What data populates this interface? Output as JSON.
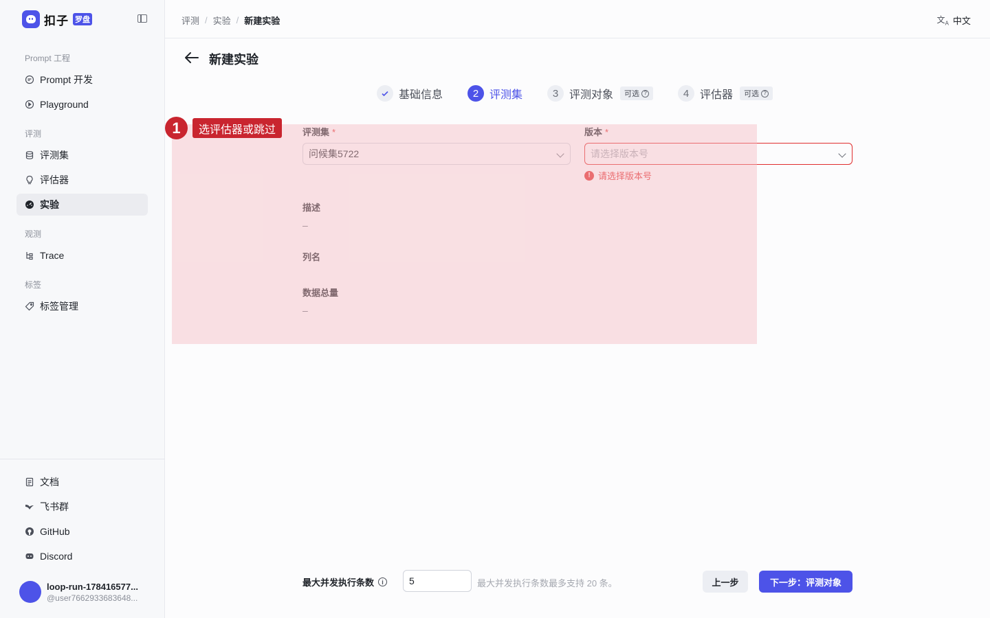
{
  "brand": {
    "name": "扣子",
    "badge": "罗盘"
  },
  "sidebar": {
    "groups": [
      {
        "label": "Prompt 工程",
        "items": [
          {
            "label": "Prompt 开发",
            "icon": "chat-bubble-icon"
          },
          {
            "label": "Playground",
            "icon": "play-circle-icon"
          }
        ]
      },
      {
        "label": "评测",
        "items": [
          {
            "label": "评测集",
            "icon": "database-icon"
          },
          {
            "label": "评估器",
            "icon": "bulb-icon"
          },
          {
            "label": "实验",
            "icon": "gauge-icon",
            "active": true
          }
        ]
      },
      {
        "label": "观测",
        "items": [
          {
            "label": "Trace",
            "icon": "tree-icon"
          }
        ]
      },
      {
        "label": "标签",
        "items": [
          {
            "label": "标签管理",
            "icon": "tag-icon"
          }
        ]
      }
    ],
    "bottom_items": [
      {
        "label": "文档",
        "icon": "document-icon"
      },
      {
        "label": "飞书群",
        "icon": "feishu-icon"
      },
      {
        "label": "GitHub",
        "icon": "github-icon"
      },
      {
        "label": "Discord",
        "icon": "discord-icon"
      }
    ],
    "user": {
      "name": "loop-run-178416577...",
      "id": "@user7662933683648..."
    }
  },
  "topbar": {
    "breadcrumb": [
      "评测",
      "实验",
      "新建实验"
    ],
    "language": "中文"
  },
  "page": {
    "title": "新建实验",
    "steps": [
      {
        "num": "1",
        "label": "基础信息",
        "state": "done"
      },
      {
        "num": "2",
        "label": "评测集",
        "state": "active"
      },
      {
        "num": "3",
        "label": "评测对象",
        "state": "pending",
        "tag": "可选"
      },
      {
        "num": "4",
        "label": "评估器",
        "state": "pending",
        "tag": "可选"
      }
    ]
  },
  "annotation": {
    "number": "1",
    "text": "选评估器或跳过"
  },
  "form": {
    "dataset": {
      "label": "评测集",
      "value": "问候集5722"
    },
    "version": {
      "label": "版本",
      "placeholder": "请选择版本号",
      "error": "请选择版本号"
    },
    "description": {
      "label": "描述",
      "value": "–"
    },
    "columns": {
      "label": "列名"
    },
    "total": {
      "label": "数据总量",
      "value": "–"
    }
  },
  "footer": {
    "concurrency_label": "最大并发执行条数",
    "concurrency_value": "5",
    "hint": "最大并发执行条数最多支持 20 条。",
    "prev_label": "上一步",
    "next_label": "下一步：评测对象"
  },
  "colors": {
    "accent": "#4d53e8",
    "error": "#e02d2d",
    "annotation": "#c9252f"
  }
}
